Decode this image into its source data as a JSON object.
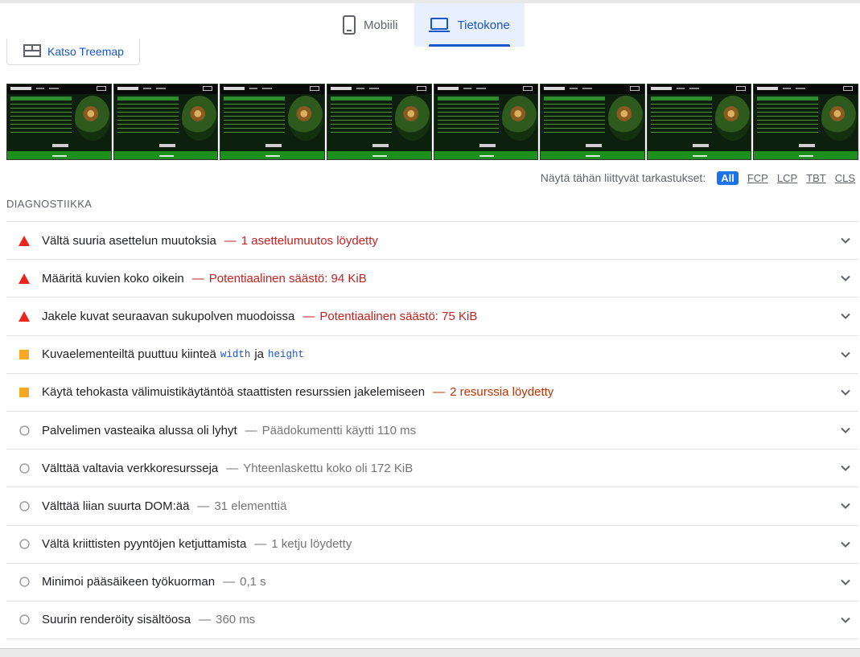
{
  "tabs": {
    "mobile_label": "Mobiili",
    "desktop_label": "Tietokone"
  },
  "treemap": {
    "label": "Katso Treemap"
  },
  "filmstrip": {
    "frame_count": 8
  },
  "filter": {
    "label": "Näytä tähän liittyvät tarkastukset:",
    "chips": [
      "All",
      "FCP",
      "LCP",
      "TBT",
      "CLS"
    ],
    "selected": "All"
  },
  "section_title": "DIAGNOSTIIKKA",
  "colors": {
    "fail": "#e8261c",
    "average": "#f9a825",
    "accent": "#1a56c8"
  },
  "audits": [
    {
      "status": "fail",
      "title": "Vältä suuria asettelun muutoksia",
      "display": "1 asettelumuutos löydetty"
    },
    {
      "status": "fail",
      "title": "Määritä kuvien koko oikein",
      "display": "Potentiaalinen säästö: 94 KiB"
    },
    {
      "status": "fail",
      "title": "Jakele kuvat seuraavan sukupolven muodoissa",
      "display": "Potentiaalinen säästö: 75 KiB"
    },
    {
      "status": "average",
      "title_pre": "Kuvaelementeiltä puuttuu kiinteä",
      "code1": "width",
      "title_mid": "ja",
      "code2": "height"
    },
    {
      "status": "average",
      "title": "Käytä tehokasta välimuistikäytäntöä staattisten resurssien jakelemiseen",
      "display": "2 resurssia löydetty"
    },
    {
      "status": "pass",
      "title": "Palvelimen vasteaika alussa oli lyhyt",
      "display": "Päädokumentti käytti 110 ms"
    },
    {
      "status": "pass",
      "title": "Välttää valtavia verkkoresursseja",
      "display": "Yhteenlaskettu koko oli 172 KiB"
    },
    {
      "status": "pass",
      "title": "Välttää liian suurta DOM:ää",
      "display": "31 elementtiä"
    },
    {
      "status": "pass",
      "title": "Vältä kriittisten pyyntöjen ketjuttamista",
      "display": "1 ketju löydetty"
    },
    {
      "status": "pass",
      "title": "Minimoi pääsäikeen työkuorman",
      "display": "0,1 s"
    },
    {
      "status": "pass",
      "title": "Suurin renderöity sisältöosa",
      "display": "360 ms"
    }
  ]
}
